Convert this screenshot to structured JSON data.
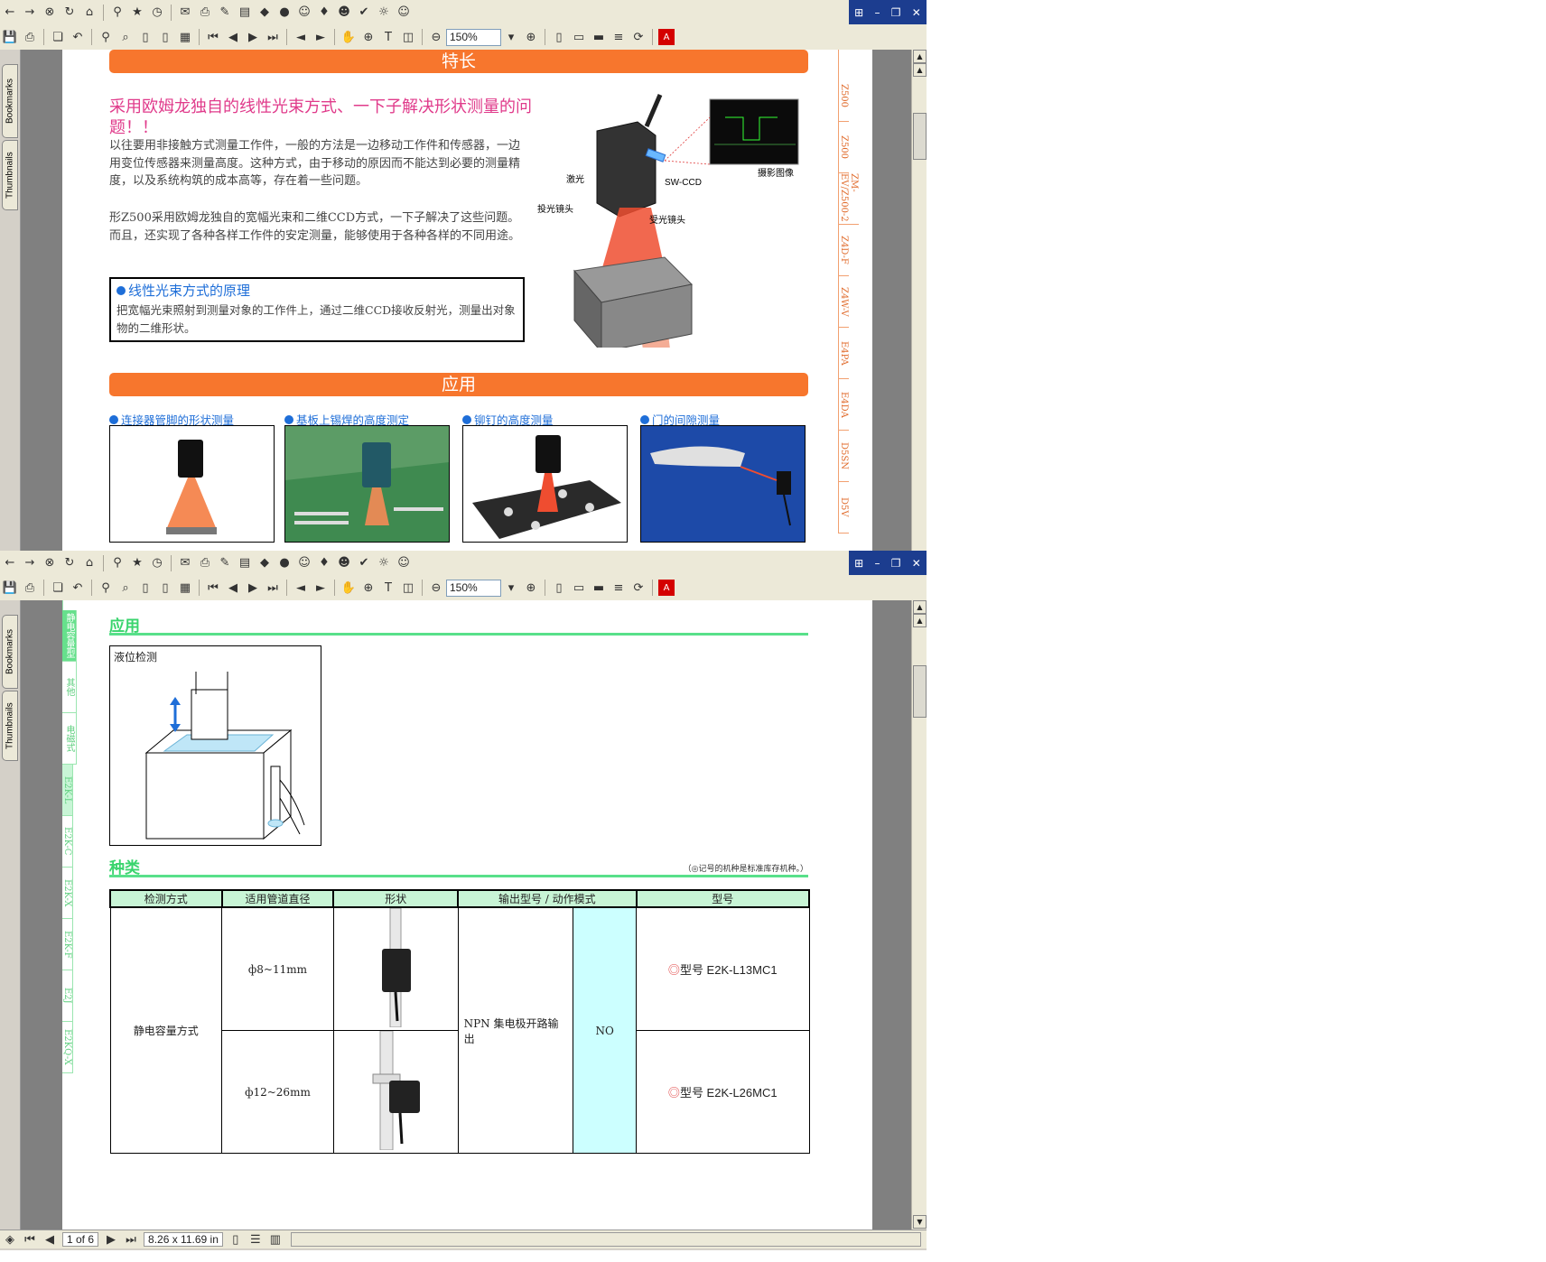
{
  "toolbar": {
    "zoom_value": "150%"
  },
  "side_tabs": {
    "bookmarks": "Bookmarks",
    "thumbnails": "Thumbnails"
  },
  "page1": {
    "section1_header": "特长",
    "headline": "采用欧姆龙独自的线性光束方式、一下子解决形状测量的问题！！",
    "paragraph1": "以往要用非接触方式测量工作件，一般的方法是一边移动工作件和传感器，一边用变位传感器来测量高度。这种方式，由于移动的原因而不能达到必要的测量精度，以及系统构筑的成本高等，存在着一些问题。",
    "paragraph2": "形Z500采用欧姆龙独自的宽幅光束和二维CCD方式，一下子解决了这些问题。而且，还实现了各种各样工作件的安定测量，能够使用于各种各样的不同用途。",
    "principle_title": "线性光束方式的原理",
    "principle_text": "把宽幅光束照射到测量对象的工作件上，通过二维CCD接收反射光，测量出对象物的二维形状。",
    "diagram_labels": {
      "laser": "激光",
      "projector_lens": "投光镜头",
      "sw_ccd": "SW-CCD",
      "receiver_lens": "受光镜头",
      "captured_image": "摄影图像"
    },
    "section2_header": "应用",
    "applications": [
      {
        "label": "连接器管脚的形状测量"
      },
      {
        "label": "基板上锡焊的高度测定"
      },
      {
        "label": "铆钉的高度测量"
      },
      {
        "label": "门的间隙测量"
      }
    ],
    "right_tabs": [
      "Z500",
      "Z500",
      "ZM-EV/Z500-2",
      "Z4D-F",
      "Z4W-V",
      "E4PA",
      "E4DA",
      "D5SN",
      "D5V"
    ]
  },
  "page2": {
    "left_tabs": [
      "静电容量型",
      "其他",
      "电磁式",
      "E2K-L",
      "E2K-C",
      "E2K-X",
      "E2K-F",
      "E2J",
      "E2KQ-X"
    ],
    "application_heading": "应用",
    "liquid_label": "液位检测",
    "types_heading": "种类",
    "types_note": "（◎记号的机种是标准库存机种。）",
    "table": {
      "headers": [
        "检测方式",
        "适用管道直径",
        "形状",
        "输出型号 / 动作模式",
        "型号"
      ],
      "method": "静电容量方式",
      "output": "NPN 集电极开路输出",
      "mode": "NO",
      "rows": [
        {
          "diameter": "ф8~11mm",
          "model": "型号 E2K-L13MC1",
          "mark": "◎"
        },
        {
          "diameter": "ф12~26mm",
          "model": "型号 E2K-L26MC1",
          "mark": "◎"
        }
      ]
    }
  },
  "statusbar": {
    "page_indicator": "1 of 6",
    "page_size": "8.26 x 11.69 in"
  },
  "colors": {
    "orange": "#f7762d",
    "pink": "#e03b8b",
    "blue": "#1e6ed8",
    "green": "#39d46d"
  }
}
